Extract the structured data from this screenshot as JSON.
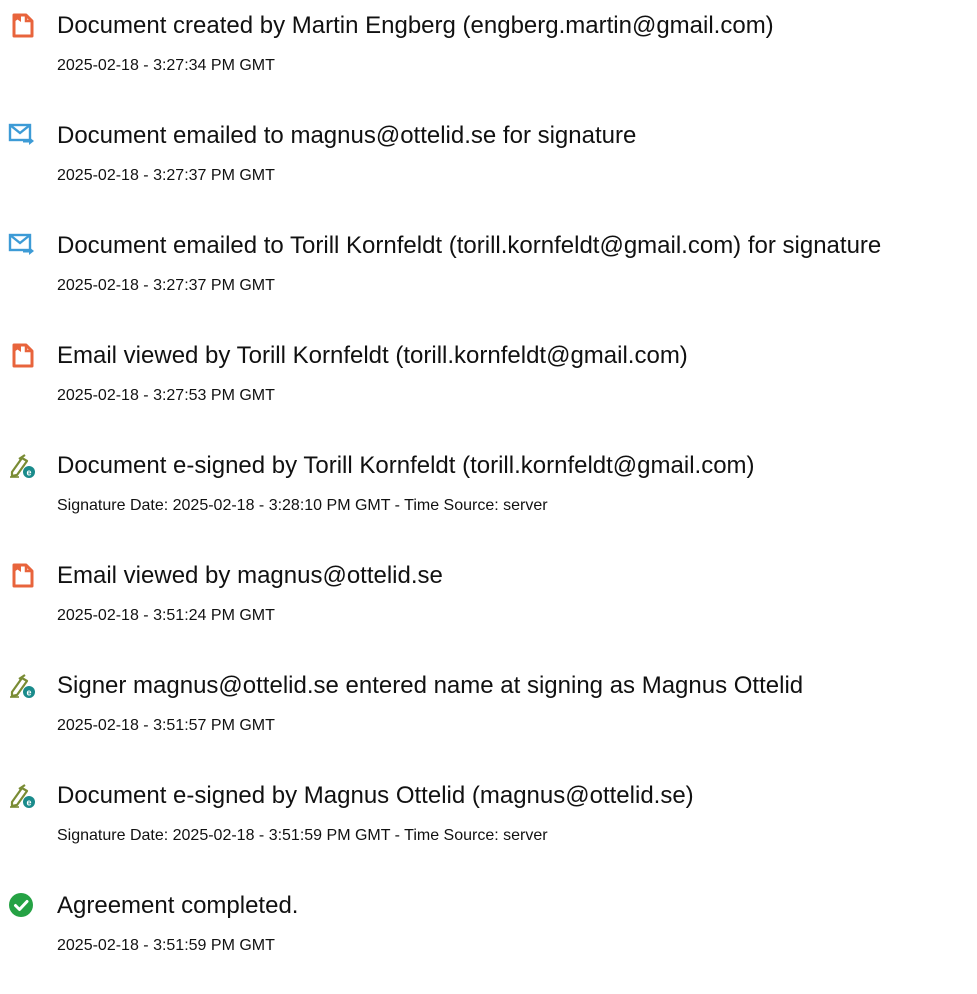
{
  "events": [
    {
      "icon": "document-created-icon",
      "title": "Document created by Martin Engberg (engberg.martin@gmail.com)",
      "detail": "2025-02-18 - 3:27:34 PM GMT"
    },
    {
      "icon": "email-sent-icon",
      "title": "Document emailed to magnus@ottelid.se for signature",
      "detail": "2025-02-18 - 3:27:37 PM GMT"
    },
    {
      "icon": "email-sent-icon",
      "title": "Document emailed to Torill Kornfeldt (torill.kornfeldt@gmail.com) for signature",
      "detail": "2025-02-18 - 3:27:37 PM GMT"
    },
    {
      "icon": "document-viewed-icon",
      "title": "Email viewed by Torill Kornfeldt (torill.kornfeldt@gmail.com)",
      "detail": "2025-02-18 - 3:27:53 PM GMT"
    },
    {
      "icon": "e-sign-icon",
      "title": "Document e-signed by Torill Kornfeldt (torill.kornfeldt@gmail.com)",
      "detail": "Signature Date: 2025-02-18 - 3:28:10 PM GMT - Time Source: server"
    },
    {
      "icon": "document-viewed-icon",
      "title": "Email viewed by magnus@ottelid.se",
      "detail": "2025-02-18 - 3:51:24 PM GMT"
    },
    {
      "icon": "e-sign-icon",
      "title": "Signer magnus@ottelid.se entered name at signing as Magnus Ottelid",
      "detail": "2025-02-18 - 3:51:57 PM GMT"
    },
    {
      "icon": "e-sign-icon",
      "title": "Document e-signed by Magnus Ottelid (magnus@ottelid.se)",
      "detail": "Signature Date: 2025-02-18 - 3:51:59 PM GMT - Time Source: server"
    },
    {
      "icon": "completed-check-icon",
      "title": "Agreement completed.",
      "detail": "2025-02-18 - 3:51:59 PM GMT"
    }
  ],
  "colors": {
    "document_icon": "#e8643c",
    "email_icon": "#3d9bd6",
    "esign_pen": "#7a8c34",
    "esign_badge": "#1a8b8b",
    "completed": "#25a244",
    "text": "#111111"
  }
}
